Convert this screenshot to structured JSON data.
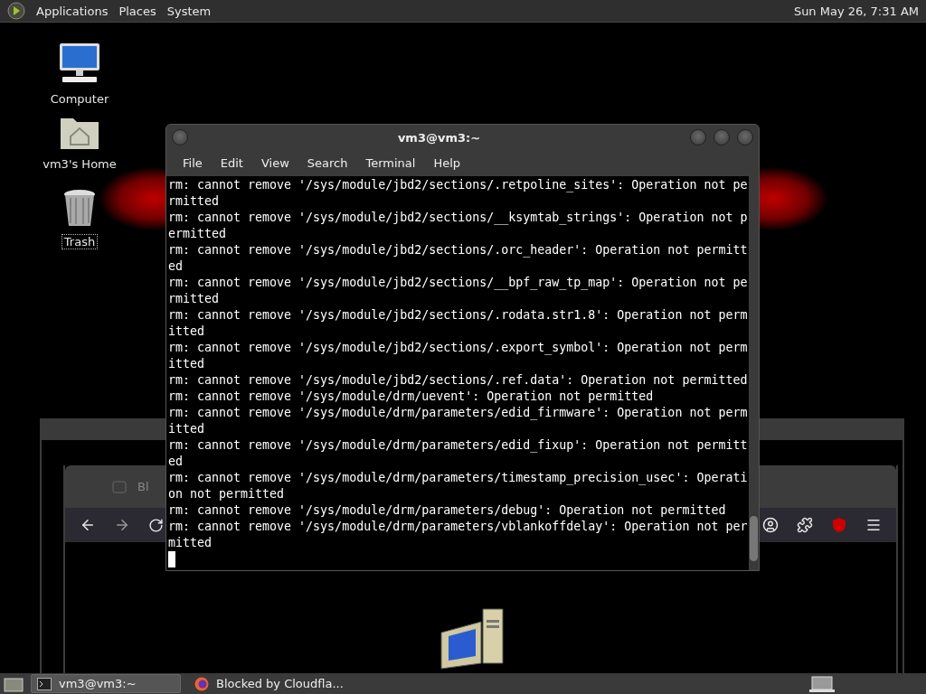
{
  "top_panel": {
    "menus": [
      "Applications",
      "Places",
      "System"
    ],
    "clock": "Sun May 26, 7:31 AM"
  },
  "desktop_icons": [
    {
      "kind": "computer",
      "label": "Computer",
      "selected": false
    },
    {
      "kind": "home",
      "label": "vm3's Home",
      "selected": false
    },
    {
      "kind": "trash",
      "label": "Trash",
      "selected": true
    }
  ],
  "browser_window": {
    "tab_title": "Bl"
  },
  "terminal": {
    "title": "vm3@vm3:~",
    "menu": [
      "File",
      "Edit",
      "View",
      "Search",
      "Terminal",
      "Help"
    ],
    "lines": [
      "rm: cannot remove '/sys/module/jbd2/sections/.retpoline_sites': Operation not pe",
      "rmitted",
      "rm: cannot remove '/sys/module/jbd2/sections/__ksymtab_strings': Operation not p",
      "ermitted",
      "rm: cannot remove '/sys/module/jbd2/sections/.orc_header': Operation not permitt",
      "ed",
      "rm: cannot remove '/sys/module/jbd2/sections/__bpf_raw_tp_map': Operation not pe",
      "rmitted",
      "rm: cannot remove '/sys/module/jbd2/sections/.rodata.str1.8': Operation not perm",
      "itted",
      "rm: cannot remove '/sys/module/jbd2/sections/.export_symbol': Operation not perm",
      "itted",
      "rm: cannot remove '/sys/module/jbd2/sections/.ref.data': Operation not permitted",
      "rm: cannot remove '/sys/module/drm/uevent': Operation not permitted",
      "rm: cannot remove '/sys/module/drm/parameters/edid_firmware': Operation not perm",
      "itted",
      "rm: cannot remove '/sys/module/drm/parameters/edid_fixup': Operation not permitt",
      "ed",
      "rm: cannot remove '/sys/module/drm/parameters/timestamp_precision_usec': Operati",
      "on not permitted",
      "rm: cannot remove '/sys/module/drm/parameters/debug': Operation not permitted",
      "rm: cannot remove '/sys/module/drm/parameters/vblankoffdelay': Operation not per",
      "mitted"
    ]
  },
  "taskbar": {
    "tasks": [
      {
        "kind": "terminal",
        "label": "vm3@vm3:~",
        "selected": true
      },
      {
        "kind": "browser",
        "label": "Blocked by Cloudfla...",
        "selected": false
      }
    ]
  }
}
